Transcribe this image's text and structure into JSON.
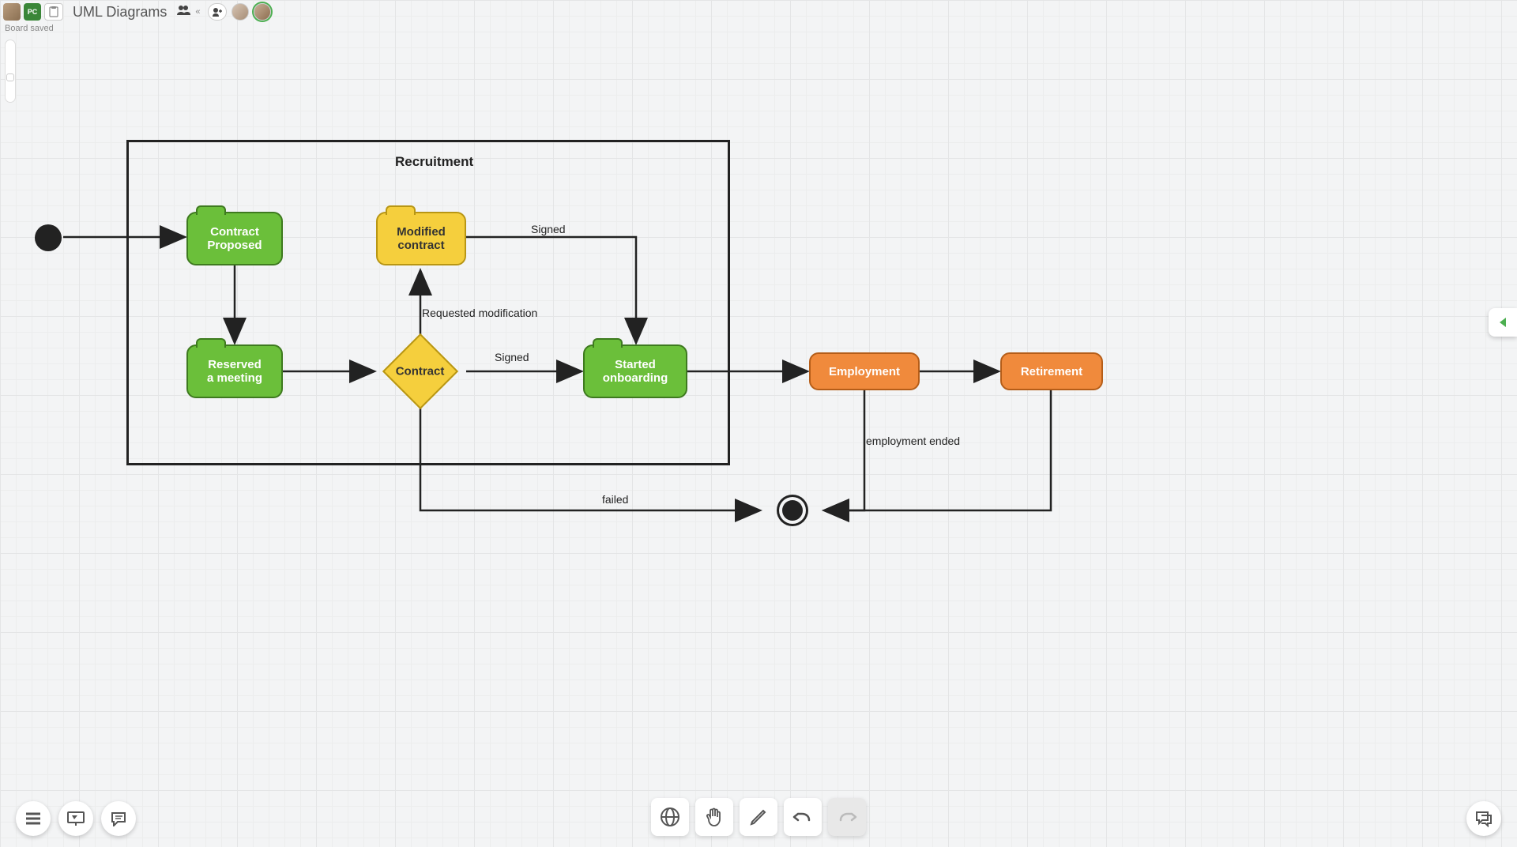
{
  "header": {
    "title": "UML Diagrams",
    "avatar2": "PC",
    "status": "Board saved"
  },
  "diagram": {
    "frame_label": "Recruitment",
    "nodes": {
      "contract_proposed": "Contract\nProposed",
      "modified_contract": "Modified\ncontract",
      "reserved_meeting": "Reserved\na meeting",
      "contract": "Contract",
      "started_onboarding": "Started\nonboarding",
      "employment": "Employment",
      "retirement": "Retirement"
    },
    "edges": {
      "signed1": "Signed",
      "requested_mod": "Requested modification",
      "signed2": "Signed",
      "failed": "failed",
      "employment_ended": "employment ended"
    }
  },
  "chart_data": {
    "type": "uml_state_machine",
    "title": "Recruitment",
    "initial_state": "Contract Proposed",
    "final_state": "end",
    "composite_states": [
      {
        "name": "Recruitment",
        "contains": [
          "Contract Proposed",
          "Modified contract",
          "Reserved a meeting",
          "Contract",
          "Started onboarding"
        ]
      }
    ],
    "states": [
      {
        "id": "Contract Proposed",
        "type": "state",
        "color": "green"
      },
      {
        "id": "Modified contract",
        "type": "state",
        "color": "yellow"
      },
      {
        "id": "Reserved a meeting",
        "type": "state",
        "color": "green"
      },
      {
        "id": "Contract",
        "type": "choice",
        "color": "yellow"
      },
      {
        "id": "Started onboarding",
        "type": "state",
        "color": "green"
      },
      {
        "id": "Employment",
        "type": "state",
        "color": "orange"
      },
      {
        "id": "Retirement",
        "type": "state",
        "color": "orange"
      },
      {
        "id": "end",
        "type": "final"
      }
    ],
    "transitions": [
      {
        "from": "initial",
        "to": "Contract Proposed",
        "label": ""
      },
      {
        "from": "Contract Proposed",
        "to": "Reserved a meeting",
        "label": ""
      },
      {
        "from": "Reserved a meeting",
        "to": "Contract",
        "label": ""
      },
      {
        "from": "Contract",
        "to": "Modified contract",
        "label": "Requested modification"
      },
      {
        "from": "Modified contract",
        "to": "Started onboarding",
        "label": "Signed"
      },
      {
        "from": "Contract",
        "to": "Started onboarding",
        "label": "Signed"
      },
      {
        "from": "Contract",
        "to": "end",
        "label": "failed"
      },
      {
        "from": "Started onboarding",
        "to": "Employment",
        "label": ""
      },
      {
        "from": "Employment",
        "to": "Retirement",
        "label": ""
      },
      {
        "from": "Employment",
        "to": "end",
        "label": "employment ended"
      },
      {
        "from": "Retirement",
        "to": "end",
        "label": ""
      }
    ]
  }
}
